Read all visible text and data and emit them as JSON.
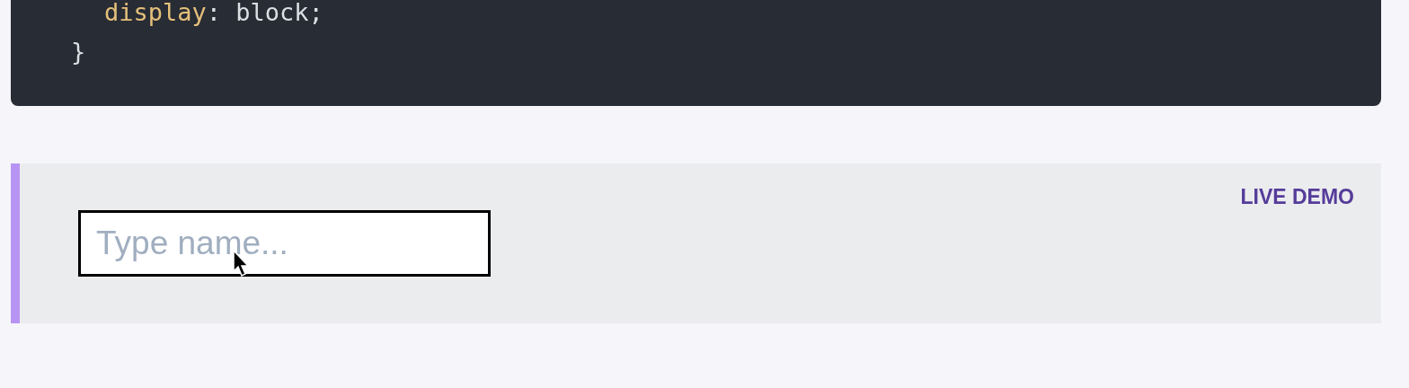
{
  "code_block": {
    "lines": [
      {
        "kind": "property",
        "property": "display",
        "value": ": block;"
      },
      {
        "kind": "brace",
        "text": "}"
      }
    ]
  },
  "demo": {
    "badge": "LIVE DEMO",
    "input": {
      "placeholder": "Type name..."
    }
  }
}
